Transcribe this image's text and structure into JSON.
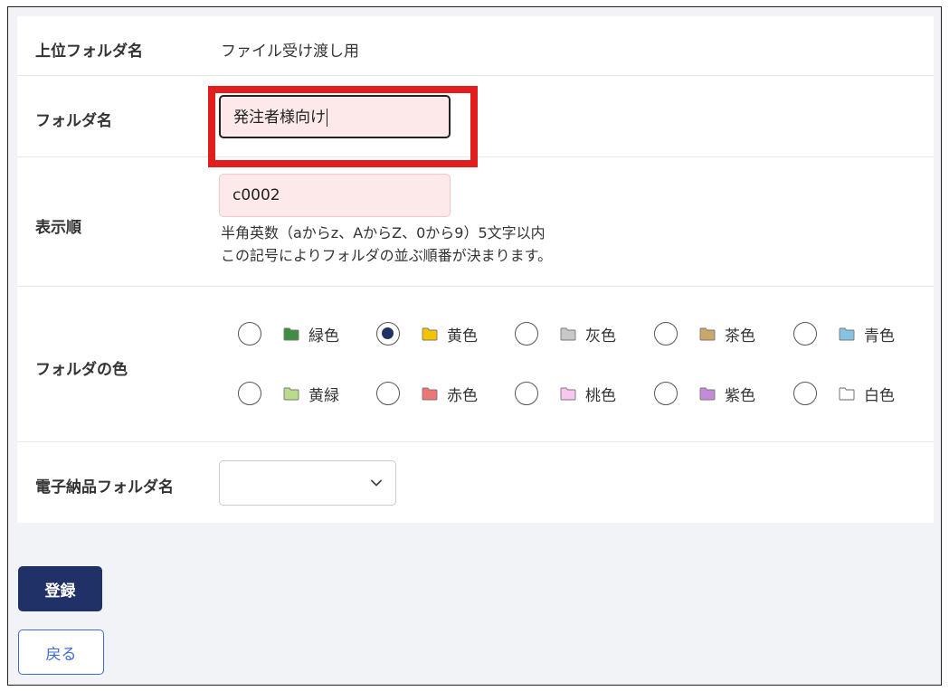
{
  "form": {
    "parent_folder": {
      "label": "上位フォルダ名",
      "value": "ファイル受け渡し用"
    },
    "folder_name": {
      "label": "フォルダ名",
      "value": "発注者様向け"
    },
    "display_order": {
      "label": "表示順",
      "value": "c0002",
      "hint_line1": "半角英数（aからz、AからZ、0から9）5文字以内",
      "hint_line2": "この記号によりフォルダの並ぶ順番が決まります。"
    },
    "folder_color": {
      "label": "フォルダの色",
      "selected": "黄色",
      "options": [
        {
          "name": "緑色",
          "color": "#3e8e41"
        },
        {
          "name": "黄色",
          "color": "#f5c400"
        },
        {
          "name": "灰色",
          "color": "#c8c8c8"
        },
        {
          "name": "茶色",
          "color": "#c9a86a"
        },
        {
          "name": "青色",
          "color": "#86c3e3"
        },
        {
          "name": "黄緑",
          "color": "#b9dc8c"
        },
        {
          "name": "赤色",
          "color": "#f07575"
        },
        {
          "name": "桃色",
          "color": "#f8c6ee"
        },
        {
          "name": "紫色",
          "color": "#c58ad8"
        },
        {
          "name": "白色",
          "color": "#ffffff"
        }
      ]
    },
    "electronic_folder": {
      "label": "電子納品フォルダ名",
      "value": ""
    }
  },
  "buttons": {
    "submit": "登録",
    "back": "戻る"
  },
  "colors": {
    "primary": "#1f3167",
    "link": "#3f6ad8",
    "input_bg": "#fde9e9",
    "highlight": "#e21d1d"
  }
}
